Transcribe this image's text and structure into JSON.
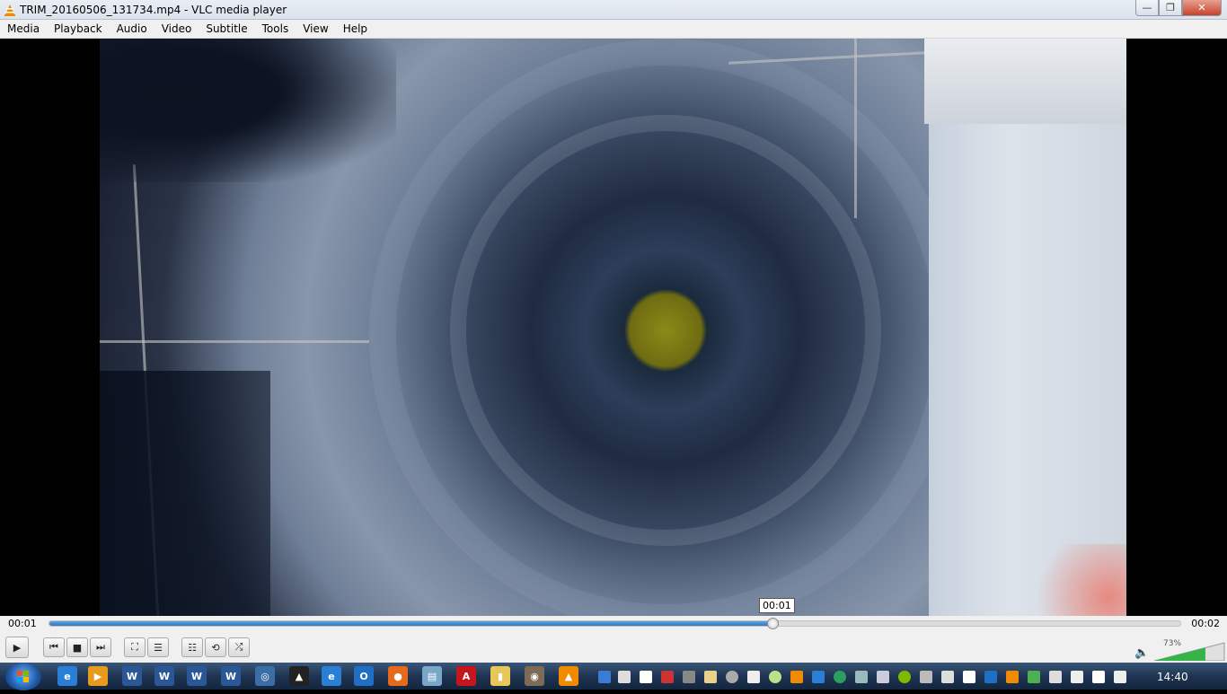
{
  "window": {
    "title": "TRIM_20160506_131734.mp4 - VLC media player",
    "controls": {
      "minimize": "—",
      "maximize": "❐",
      "close": "✕"
    }
  },
  "menu": {
    "items": [
      {
        "label": "Media"
      },
      {
        "label": "Playback"
      },
      {
        "label": "Audio"
      },
      {
        "label": "Video"
      },
      {
        "label": "Subtitle"
      },
      {
        "label": "Tools"
      },
      {
        "label": "View"
      },
      {
        "label": "Help"
      }
    ]
  },
  "seek": {
    "elapsed": "00:01",
    "total": "00:02",
    "tooltip": "00:01",
    "progress": 0.64
  },
  "controls": {
    "play": "▶",
    "prev": "⏮",
    "stop": "■",
    "next": "⏭",
    "fullscreen": "⛶",
    "extended": "☰",
    "playlist": "☷",
    "loop": "⟲",
    "shuffle": "⤮"
  },
  "volume": {
    "percent_label": "73%",
    "level": 0.73,
    "icon": "🔈"
  },
  "taskbar": {
    "clock": "14:40",
    "apps": [
      {
        "name": "ie-icon",
        "glyph": "e",
        "color": "#2a7fd4"
      },
      {
        "name": "media-icon",
        "glyph": "▶",
        "color": "#e89a1c"
      },
      {
        "name": "word-icon-1",
        "glyph": "W",
        "color": "#2b5797"
      },
      {
        "name": "word-icon-2",
        "glyph": "W",
        "color": "#2b5797"
      },
      {
        "name": "word-icon-3",
        "glyph": "W",
        "color": "#2b5797"
      },
      {
        "name": "word-icon-4",
        "glyph": "W",
        "color": "#2b5797"
      },
      {
        "name": "network-icon",
        "glyph": "◎",
        "color": "#3a6ea5"
      },
      {
        "name": "app-icon-arrow",
        "glyph": "▲",
        "color": "#222"
      },
      {
        "name": "ie-icon-2",
        "glyph": "e",
        "color": "#2a7fd4"
      },
      {
        "name": "outlook-icon",
        "glyph": "O",
        "color": "#1f6fc4"
      },
      {
        "name": "firefox-icon",
        "glyph": "●",
        "color": "#e66a1c"
      },
      {
        "name": "notes-icon",
        "glyph": "▤",
        "color": "#7aa7c7"
      },
      {
        "name": "acrobat-icon",
        "glyph": "A",
        "color": "#c4161c"
      },
      {
        "name": "folder-icon",
        "glyph": "▮",
        "color": "#e8c65a"
      },
      {
        "name": "gimp-icon",
        "glyph": "◉",
        "color": "#7d6b55"
      },
      {
        "name": "vlc-icon",
        "glyph": "▲",
        "color": "#f08a00"
      }
    ]
  }
}
